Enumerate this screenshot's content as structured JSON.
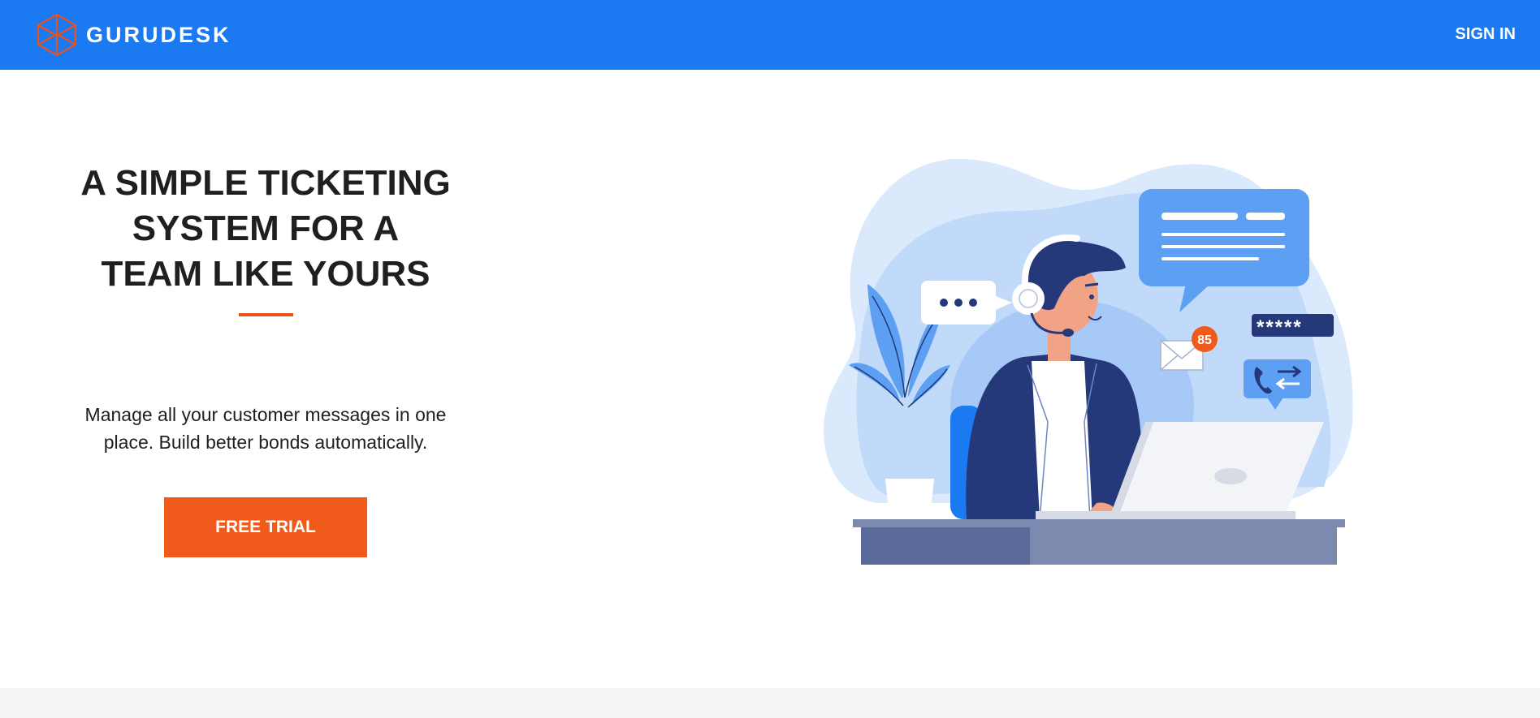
{
  "header": {
    "brand_name": "GURUDESK",
    "brand_icon": "cube-logo-icon",
    "sign_in_label": "SIGN IN"
  },
  "hero": {
    "headline": "A SIMPLE TICKETING\nSYSTEM FOR A\nTEAM LIKE YOURS",
    "description": "Manage all your customer messages in one place. Build better bonds automatically.",
    "cta_label": "FREE TRIAL"
  },
  "illustration": {
    "notification_count": "85",
    "password_mask": "*****",
    "icons": [
      "chat-bubble-icon",
      "envelope-icon",
      "phone-transfer-icon",
      "password-field-icon",
      "laptop-icon",
      "plant-icon",
      "support-agent-figure"
    ]
  },
  "colors": {
    "header_bg": "#1b7af2",
    "accent": "#f05a1a",
    "navy": "#24387a",
    "light_blue": "#dbe9fd"
  }
}
